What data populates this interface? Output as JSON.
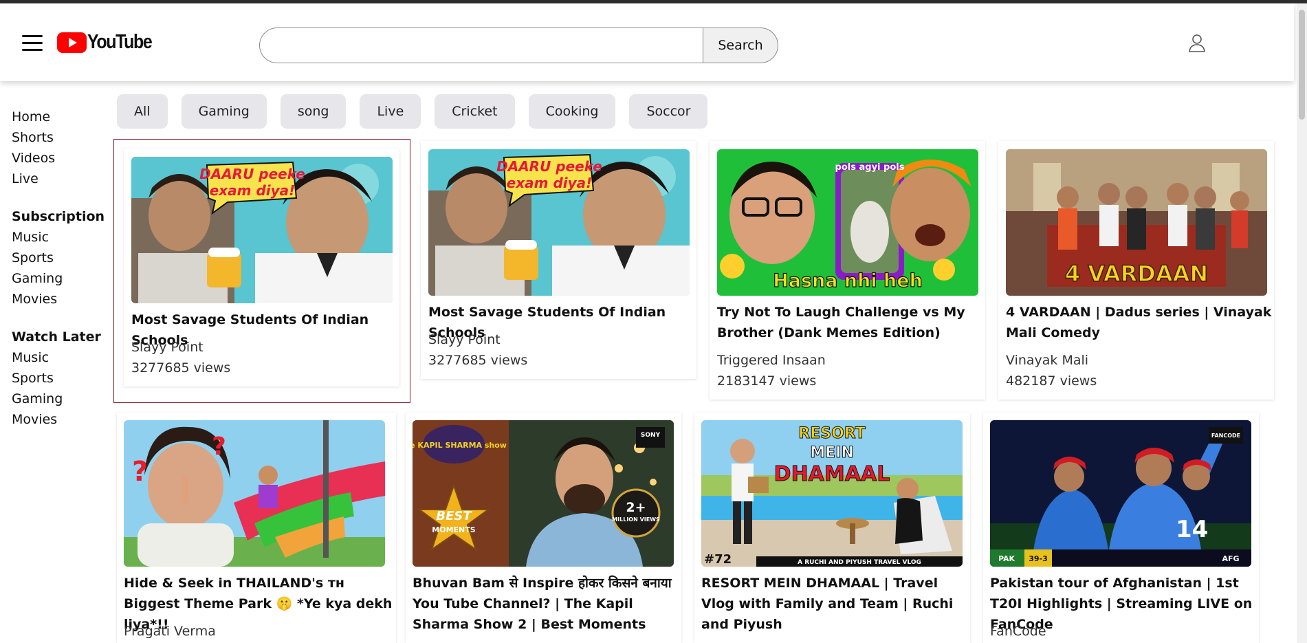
{
  "header": {
    "logo_text": "YouTube",
    "search": {
      "value": "",
      "placeholder": "",
      "button_label": "Search"
    },
    "colors": {
      "brand_red": "#ff0000"
    }
  },
  "sidebar": {
    "main_items": [
      "Home",
      "Shorts",
      "Videos",
      "Live"
    ],
    "sections": [
      {
        "heading": "Subscription",
        "items": [
          "Music",
          "Sports",
          "Gaming",
          "Movies"
        ]
      },
      {
        "heading": "Watch Later",
        "items": [
          "Music",
          "Sports",
          "Gaming",
          "Movies"
        ]
      }
    ]
  },
  "chips": [
    "All",
    "Gaming",
    "song",
    "Live",
    "Cricket",
    "Cooking",
    "Soccor"
  ],
  "videos": [
    {
      "title": "Most Savage Students Of Indian Schools",
      "channel": "Slayy Point",
      "views": "3277685 views",
      "thumb_text": "DAARU peeke exam diya!",
      "selected": true
    },
    {
      "title": "Most Savage Students Of Indian Schools",
      "channel": "Slayy Point",
      "views": "3277685 views",
      "thumb_text": "DAARU peeke exam diya!"
    },
    {
      "title": "Try Not To Laugh Challenge vs My Brother (Dank Memes Edition)",
      "channel": "Triggered Insaan",
      "views": "2183147 views",
      "thumb_text": "Hasna nhi heh",
      "thumb_text_2": "pols agyi pols"
    },
    {
      "title": "4 VARDAAN | Dadus series | Vinayak Mali Comedy",
      "channel": "Vinayak Mali",
      "views": "482187 views",
      "thumb_text": "4 VARDAAN"
    },
    {
      "title": "Hide & Seek in THAILAND's ᴛʜ Biggest Theme Park 🤫 *Ye kya dekh liya*!!",
      "channel": "Pragati Verma",
      "views": ""
    },
    {
      "title": "Bhuvan Bam से Inspire होकर किसने बनाया You Tube Channel? | The Kapil Sharma Show 2 | Best Moments",
      "channel": "",
      "views": "",
      "thumb_text": "BEST MOMENTS",
      "thumb_text_2": "2+ MILLION VIEWS",
      "thumb_text_3": "the KAPIL SHARMA show",
      "thumb_text_4": "SONY"
    },
    {
      "title": "RESORT MEIN DHAMAAL | Travel Vlog with Family and Team | Ruchi and Piyush",
      "channel": "",
      "views": "",
      "thumb_text": "RESORT MEIN DHAMAAL",
      "thumb_text_2": "#72",
      "thumb_text_3": "A RUCHI AND PIYUSH TRAVEL VLOG"
    },
    {
      "title": "Pakistan tour of Afghanistan | 1st T20I Highlights | Streaming LIVE on FanCode",
      "channel": "FanCode",
      "views": "",
      "thumb_text": "FANCODE",
      "thumb_text_2": "PAK",
      "thumb_text_3": "AFG",
      "thumb_text_4": "39-3"
    }
  ]
}
